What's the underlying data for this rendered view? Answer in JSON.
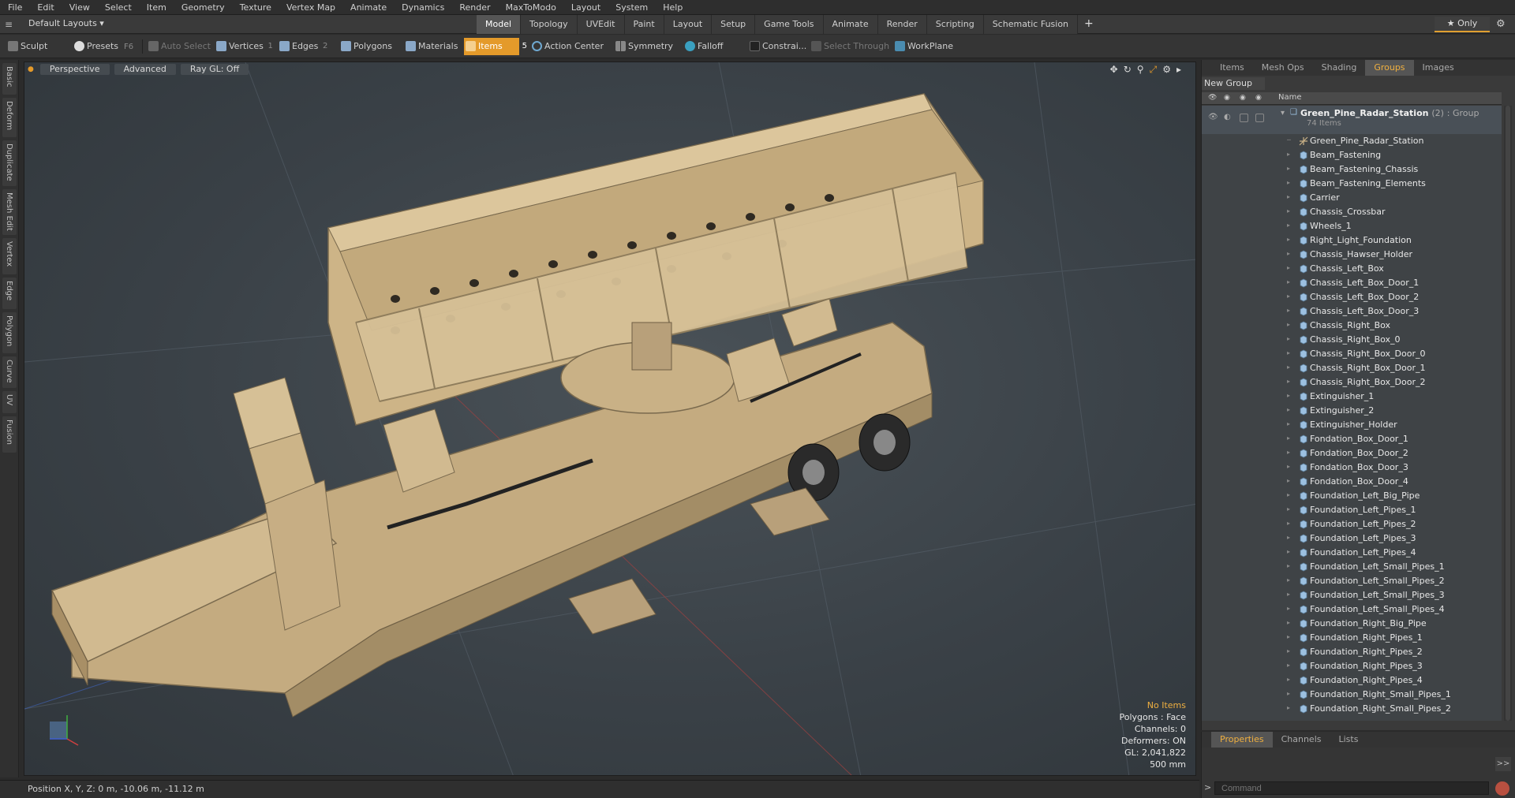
{
  "menu": [
    "File",
    "Edit",
    "View",
    "Select",
    "Item",
    "Geometry",
    "Texture",
    "Vertex Map",
    "Animate",
    "Dynamics",
    "Render",
    "MaxToModo",
    "Layout",
    "System",
    "Help"
  ],
  "layout_dropdown": "Default Layouts ▾",
  "layout_tabs": [
    "Model",
    "Topology",
    "UVEdit",
    "Paint",
    "Layout",
    "Setup",
    "Game Tools",
    "Animate",
    "Render",
    "Scripting",
    "Schematic Fusion"
  ],
  "layout_active": "Model",
  "only_label": "★ Only",
  "toolbar": {
    "sculpt": "Sculpt",
    "presets": "Presets",
    "presets_key": "F6",
    "auto_select": "Auto Select",
    "vertices": "Vertices",
    "vertices_count": "1",
    "edges": "Edges",
    "edges_count": "2",
    "polygons": "Polygons",
    "materials": "Materials",
    "items": "Items",
    "items_count": "5",
    "action_center": "Action Center",
    "symmetry": "Symmetry",
    "falloff": "Falloff",
    "constraints": "Constrai...",
    "select_through": "Select Through",
    "workplane": "WorkPlane"
  },
  "vtabs": [
    "Basic",
    "Deform",
    "Duplicate",
    "Mesh Edit",
    "Vertex",
    "Edge",
    "Polygon",
    "Curve",
    "UV",
    "Fusion"
  ],
  "viewport": {
    "view": "Perspective",
    "shading": "Advanced",
    "raygl": "Ray GL: Off",
    "info": {
      "no_items": "No Items",
      "polygons": "Polygons : Face",
      "channels": "Channels: 0",
      "deformers": "Deformers: ON",
      "gl": "GL: 2,041,822",
      "scale": "500 mm"
    }
  },
  "status": {
    "position": "Position X, Y, Z:   0 m, -10.06 m, -11.12 m"
  },
  "right_tabs": [
    "Items",
    "Mesh Ops",
    "Shading",
    "Groups",
    "Images"
  ],
  "right_active": "Groups",
  "new_group": "New Group",
  "col_name": "Name",
  "group": {
    "name": "Green_Pine_Radar_Station",
    "count": "(2)",
    "type": ": Group",
    "sub": "74 Items"
  },
  "items": [
    "Green_Pine_Radar_Station",
    "Beam_Fastening",
    "Beam_Fastening_Chassis",
    "Beam_Fastening_Elements",
    "Carrier",
    "Chassis_Crossbar",
    "Wheels_1",
    "Right_Light_Foundation",
    "Chassis_Hawser_Holder",
    "Chassis_Left_Box",
    "Chassis_Left_Box_Door_1",
    "Chassis_Left_Box_Door_2",
    "Chassis_Left_Box_Door_3",
    "Chassis_Right_Box",
    "Chassis_Right_Box_0",
    "Chassis_Right_Box_Door_0",
    "Chassis_Right_Box_Door_1",
    "Chassis_Right_Box_Door_2",
    "Extinguisher_1",
    "Extinguisher_2",
    "Extinguisher_Holder",
    "Fondation_Box_Door_1",
    "Fondation_Box_Door_2",
    "Fondation_Box_Door_3",
    "Fondation_Box_Door_4",
    "Foundation_Left_Big_Pipe",
    "Foundation_Left_Pipes_1",
    "Foundation_Left_Pipes_2",
    "Foundation_Left_Pipes_3",
    "Foundation_Left_Pipes_4",
    "Foundation_Left_Small_Pipes_1",
    "Foundation_Left_Small_Pipes_2",
    "Foundation_Left_Small_Pipes_3",
    "Foundation_Left_Small_Pipes_4",
    "Foundation_Right_Big_Pipe",
    "Foundation_Right_Pipes_1",
    "Foundation_Right_Pipes_2",
    "Foundation_Right_Pipes_3",
    "Foundation_Right_Pipes_4",
    "Foundation_Right_Small_Pipes_1",
    "Foundation_Right_Small_Pipes_2"
  ],
  "bottom_tabs": [
    "Properties",
    "Channels",
    "Lists"
  ],
  "bottom_active": "Properties",
  "command_placeholder": "Command",
  "colors": {
    "accent": "#e49a2a",
    "model_tan": "#c9b186",
    "model_dark": "#8f7d5c"
  }
}
